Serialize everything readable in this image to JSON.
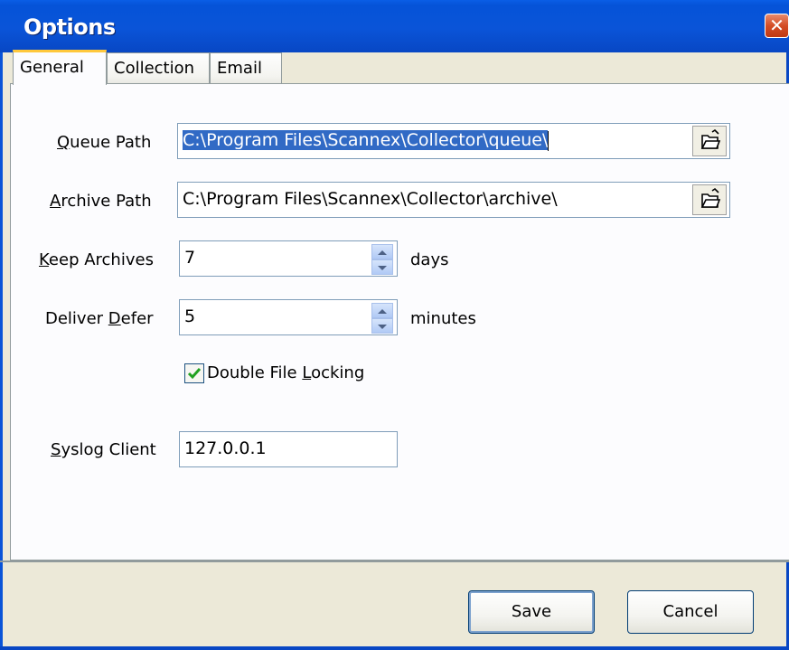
{
  "window": {
    "title": "Options",
    "close_symbol": "✕"
  },
  "tabs": [
    {
      "label": "General",
      "active": true
    },
    {
      "label": "Collection",
      "active": false
    },
    {
      "label": "Email",
      "active": false
    }
  ],
  "general": {
    "queue_path": {
      "label": "Queue Path",
      "accel": "Q",
      "label_rest": "ueue Path",
      "value": "C:\\Program Files\\Scannex\\Collector\\queue\\"
    },
    "archive_path": {
      "label": "Archive Path",
      "accel": "A",
      "label_rest": "rchive Path",
      "value": "C:\\Program Files\\Scannex\\Collector\\archive\\"
    },
    "keep_archives": {
      "label_pre": "",
      "accel": "K",
      "label_rest": "eep Archives",
      "value": "7",
      "unit": "days"
    },
    "deliver_defer": {
      "label_pre": "Deliver ",
      "accel": "D",
      "label_rest": "efer",
      "value": "5",
      "unit": "minutes"
    },
    "double_file_locking": {
      "label_pre": "Double File ",
      "accel": "L",
      "label_rest": "ocking",
      "checked": true
    },
    "syslog_client": {
      "label_pre": "",
      "accel": "S",
      "label_rest": "yslog Client",
      "value": "127.0.0.1"
    }
  },
  "buttons": {
    "save": "Save",
    "cancel": "Cancel"
  },
  "icons": {
    "browse": "open-folder-icon",
    "close": "close-icon",
    "spin_up": "spin-up-icon",
    "spin_down": "spin-down-icon",
    "check": "checkmark-icon"
  },
  "colors": {
    "titlebar": "#0a54d8",
    "selection": "#316ac5",
    "tab_highlight": "#ffc83c",
    "checkbox_check": "#21a121"
  }
}
